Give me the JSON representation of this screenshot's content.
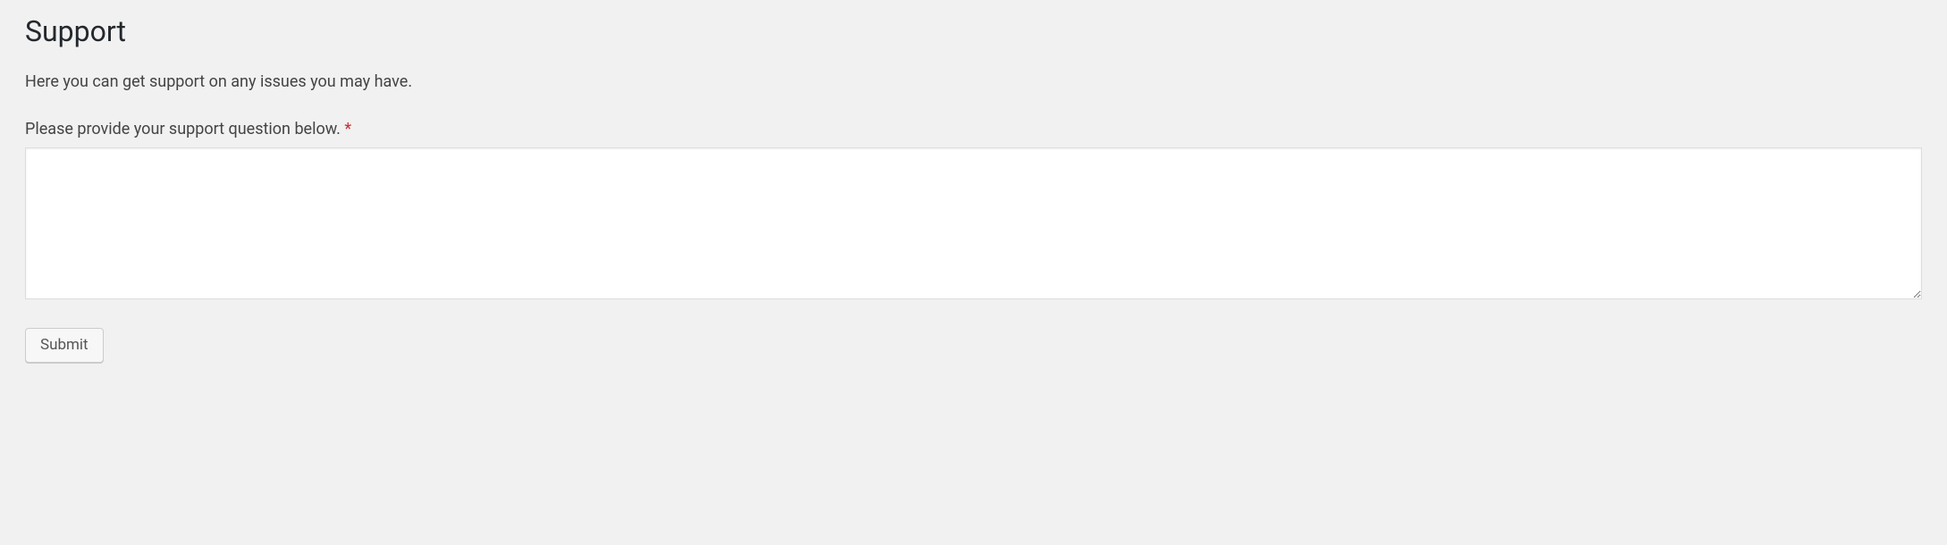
{
  "page": {
    "title": "Support",
    "intro": "Here you can get support on any issues you may have."
  },
  "form": {
    "question_label": "Please provide your support question below.",
    "required_marker": "*",
    "question_value": "",
    "submit_label": "Submit"
  }
}
